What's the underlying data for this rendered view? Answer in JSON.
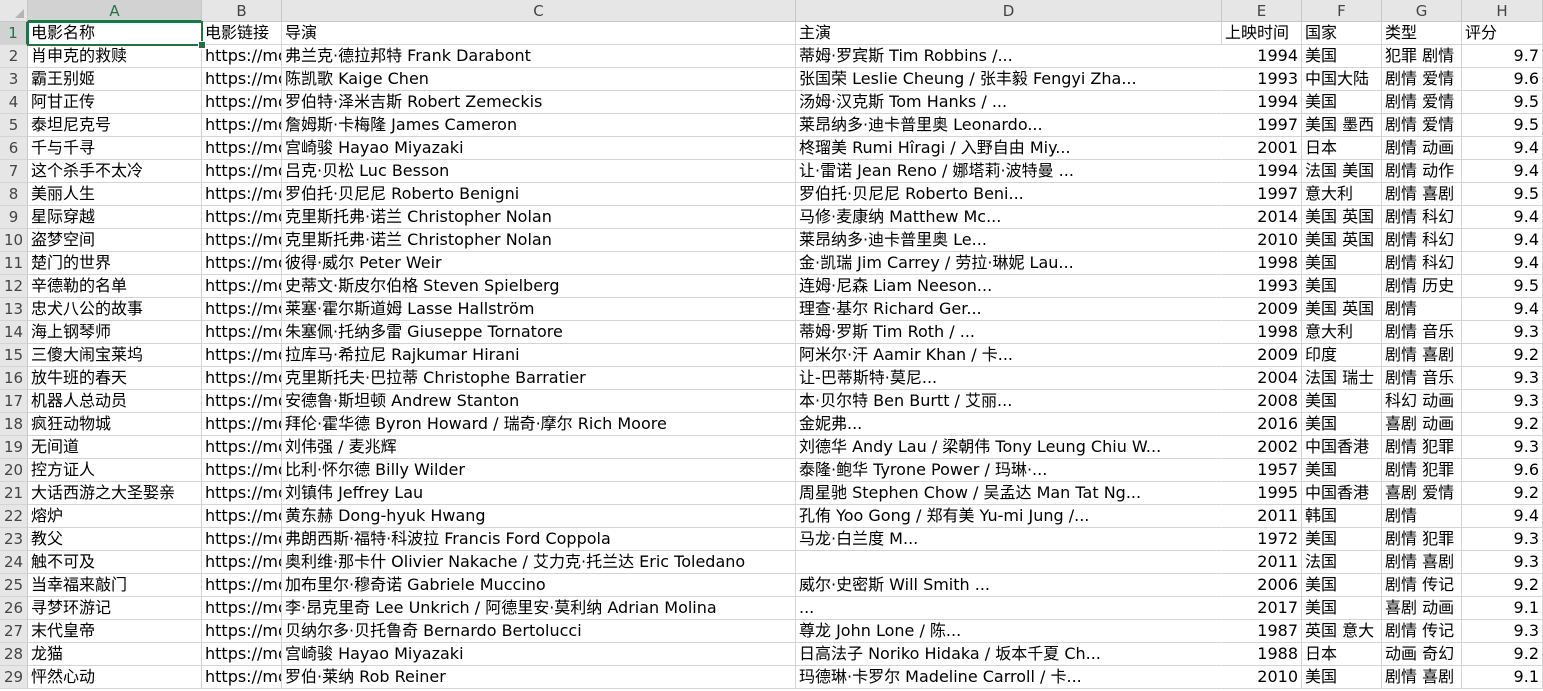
{
  "sheet": {
    "columns": [
      "A",
      "B",
      "C",
      "D",
      "E",
      "F",
      "G",
      "H"
    ],
    "selected_column": "A",
    "selected_row": "1",
    "header_row": {
      "num": "1",
      "cells": [
        "电影名称",
        "电影链接",
        "导演",
        "主演",
        "上映时间",
        "国家",
        "类型",
        "评分"
      ]
    },
    "rows": [
      {
        "num": "2",
        "cells": [
          "肖申克的救赎",
          "https://mo",
          "弗兰克·德拉邦特 Frank Darabont",
          "蒂姆·罗宾斯 Tim Robbins /...",
          "1994",
          "美国",
          "犯罪 剧情",
          "9.7"
        ]
      },
      {
        "num": "3",
        "cells": [
          "霸王别姬",
          "https://mo",
          "陈凯歌 Kaige Chen",
          "张国荣 Leslie Cheung / 张丰毅 Fengyi Zha...",
          "1993",
          "中国大陆",
          "剧情 爱情",
          "9.6"
        ]
      },
      {
        "num": "4",
        "cells": [
          "阿甘正传",
          "https://mo",
          "罗伯特·泽米吉斯 Robert Zemeckis",
          "汤姆·汉克斯 Tom Hanks / ...",
          "1994",
          "美国",
          "剧情 爱情",
          "9.5"
        ]
      },
      {
        "num": "5",
        "cells": [
          "泰坦尼克号",
          "https://mo",
          "詹姆斯·卡梅隆 James Cameron",
          "莱昂纳多·迪卡普里奥 Leonardo...",
          "1997",
          "美国 墨西",
          "剧情 爱情",
          "9.5"
        ]
      },
      {
        "num": "6",
        "cells": [
          "千与千寻",
          "https://mo",
          "宫崎骏 Hayao Miyazaki",
          "柊瑠美 Rumi Hîragi / 入野自由 Miy...",
          "2001",
          "日本",
          "剧情 动画",
          "9.4"
        ]
      },
      {
        "num": "7",
        "cells": [
          "这个杀手不太冷",
          "https://mo",
          "吕克·贝松 Luc Besson",
          "让·雷诺 Jean Reno / 娜塔莉·波特曼 ...",
          "1994",
          "法国 美国",
          "剧情 动作",
          "9.4"
        ]
      },
      {
        "num": "8",
        "cells": [
          "美丽人生",
          "https://mo",
          "罗伯托·贝尼尼 Roberto Benigni",
          "罗伯托·贝尼尼 Roberto Beni...",
          "1997",
          "意大利",
          "剧情 喜剧",
          "9.5"
        ]
      },
      {
        "num": "9",
        "cells": [
          "星际穿越",
          "https://mo",
          "克里斯托弗·诺兰 Christopher Nolan",
          "马修·麦康纳 Matthew Mc...",
          "2014",
          "美国 英国",
          "剧情 科幻",
          "9.4"
        ]
      },
      {
        "num": "10",
        "cells": [
          "盗梦空间",
          "https://mo",
          "克里斯托弗·诺兰 Christopher Nolan",
          "莱昂纳多·迪卡普里奥 Le...",
          "2010",
          "美国 英国",
          "剧情 科幻",
          "9.4"
        ]
      },
      {
        "num": "11",
        "cells": [
          "楚门的世界",
          "https://mo",
          "彼得·威尔 Peter Weir",
          "金·凯瑞 Jim Carrey / 劳拉·琳妮 Lau...",
          "1998",
          "美国",
          "剧情 科幻",
          "9.4"
        ]
      },
      {
        "num": "12",
        "cells": [
          "辛德勒的名单",
          "https://mo",
          "史蒂文·斯皮尔伯格 Steven Spielberg",
          "连姆·尼森 Liam Neeson...",
          "1993",
          "美国",
          "剧情 历史",
          "9.5"
        ]
      },
      {
        "num": "13",
        "cells": [
          "忠犬八公的故事",
          "https://mo",
          "莱塞·霍尔斯道姆 Lasse Hallström",
          "理查·基尔 Richard Ger...",
          "2009",
          "美国 英国",
          "剧情",
          "9.4"
        ]
      },
      {
        "num": "14",
        "cells": [
          "海上钢琴师",
          "https://mo",
          "朱塞佩·托纳多雷 Giuseppe Tornatore",
          "蒂姆·罗斯 Tim Roth / ...",
          "1998",
          "意大利",
          "剧情 音乐",
          "9.3"
        ]
      },
      {
        "num": "15",
        "cells": [
          "三傻大闹宝莱坞",
          "https://mo",
          "拉库马·希拉尼 Rajkumar Hirani",
          "阿米尔·汗 Aamir Khan / 卡...",
          "2009",
          "印度",
          "剧情 喜剧",
          "9.2"
        ]
      },
      {
        "num": "16",
        "cells": [
          "放牛班的春天",
          "https://mo",
          "克里斯托夫·巴拉蒂 Christophe Barratier",
          "让-巴蒂斯特·莫尼...",
          "2004",
          "法国 瑞士",
          "剧情 音乐",
          "9.3"
        ]
      },
      {
        "num": "17",
        "cells": [
          "机器人总动员",
          "https://mo",
          "安德鲁·斯坦顿 Andrew Stanton",
          "本·贝尔特 Ben Burtt / 艾丽...",
          "2008",
          "美国",
          "科幻 动画",
          "9.3"
        ]
      },
      {
        "num": "18",
        "cells": [
          "疯狂动物城",
          "https://mo",
          "拜伦·霍华德 Byron Howard / 瑞奇·摩尔 Rich Moore",
          "金妮弗...",
          "2016",
          "美国",
          "喜剧 动画",
          "9.2"
        ]
      },
      {
        "num": "19",
        "cells": [
          "无间道",
          "https://mo",
          "刘伟强 / 麦兆辉",
          "刘德华 Andy Lau / 梁朝伟 Tony Leung Chiu W...",
          "2002",
          "中国香港",
          "剧情 犯罪",
          "9.3"
        ]
      },
      {
        "num": "20",
        "cells": [
          "控方证人",
          "https://mo",
          "比利·怀尔德 Billy Wilder",
          "泰隆·鲍华 Tyrone Power / 玛琳·...",
          "1957",
          "美国",
          "剧情 犯罪",
          "9.6"
        ]
      },
      {
        "num": "21",
        "cells": [
          "大话西游之大圣娶亲",
          "https://mo",
          "刘镇伟 Jeffrey Lau",
          "周星驰 Stephen Chow / 吴孟达 Man Tat Ng...",
          "1995",
          "中国香港",
          "喜剧 爱情",
          "9.2"
        ]
      },
      {
        "num": "22",
        "cells": [
          "熔炉",
          "https://mo",
          "黄东赫 Dong-hyuk Hwang",
          "孔侑 Yoo Gong / 郑有美 Yu-mi Jung /...",
          "2011",
          "韩国",
          "剧情",
          "9.4"
        ]
      },
      {
        "num": "23",
        "cells": [
          "教父",
          "https://mo",
          "弗朗西斯·福特·科波拉 Francis Ford Coppola",
          "马龙·白兰度 M...",
          "1972",
          "美国",
          "剧情 犯罪",
          "9.3"
        ]
      },
      {
        "num": "24",
        "cells": [
          "触不可及",
          "https://mo",
          "奥利维·那卡什 Olivier Nakache / 艾力克·托兰达 Eric Toledano",
          "",
          "2011",
          "法国",
          "剧情 喜剧",
          "9.3"
        ]
      },
      {
        "num": "25",
        "cells": [
          "当幸福来敲门",
          "https://mo",
          "加布里尔·穆奇诺 Gabriele Muccino",
          "威尔·史密斯 Will Smith ...",
          "2006",
          "美国",
          "剧情 传记",
          "9.2"
        ]
      },
      {
        "num": "26",
        "cells": [
          "寻梦环游记",
          "https://mo",
          "李·昂克里奇 Lee Unkrich / 阿德里安·莫利纳 Adrian Molina",
          "...",
          "2017",
          "美国",
          "喜剧 动画",
          "9.1"
        ]
      },
      {
        "num": "27",
        "cells": [
          "末代皇帝",
          "https://mo",
          "贝纳尔多·贝托鲁奇 Bernardo Bertolucci",
          "尊龙 John Lone / 陈...",
          "1987",
          "英国 意大",
          "剧情 传记",
          "9.3"
        ]
      },
      {
        "num": "28",
        "cells": [
          "龙猫",
          "https://mo",
          "宫崎骏 Hayao Miyazaki",
          "日高法子 Noriko Hidaka / 坂本千夏 Ch...",
          "1988",
          "日本",
          "动画 奇幻",
          "9.2"
        ]
      },
      {
        "num": "29",
        "cells": [
          "怦然心动",
          "https://mo",
          "罗伯·莱纳 Rob Reiner",
          "玛德琳·卡罗尔 Madeline Carroll / 卡...",
          "2010",
          "美国",
          "剧情 喜剧",
          "9.1"
        ]
      }
    ]
  }
}
